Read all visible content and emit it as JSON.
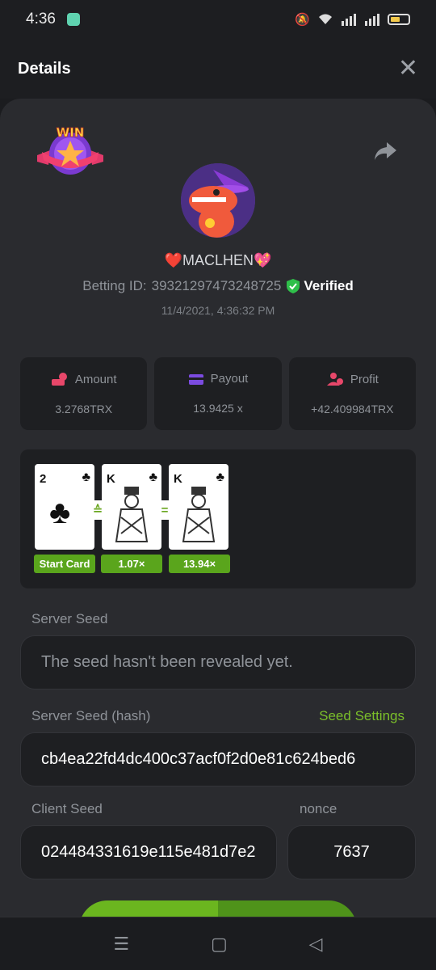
{
  "status": {
    "time": "4:36"
  },
  "header": {
    "title": "Details",
    "close_label": "✕"
  },
  "player": {
    "name": "MACLHEN",
    "betting_id_label": "Betting ID:",
    "betting_id": "39321297473248725",
    "verified_label": "Verified",
    "datetime": "11/4/2021, 4:36:32 PM"
  },
  "stats": [
    {
      "label": "Amount",
      "value": "3.2768TRX",
      "icon": "money-bag-icon",
      "color": "#e8476a"
    },
    {
      "label": "Payout",
      "value": "13.9425 x",
      "icon": "wallet-icon",
      "color": "#7b4be0"
    },
    {
      "label": "Profit",
      "value": "+42.409984TRX",
      "icon": "user-coin-icon",
      "color": "#e8476a"
    }
  ],
  "cards": [
    {
      "rank": "2",
      "suit": "♣",
      "multiplier": "Start Card"
    },
    {
      "rank": "K",
      "suit": "♣",
      "multiplier": "1.07×"
    },
    {
      "rank": "K",
      "suit": "♣",
      "multiplier": "13.94×"
    }
  ],
  "operators": [
    "≙",
    "="
  ],
  "seeds": {
    "server_seed_label": "Server Seed",
    "server_seed_value": "The seed hasn't been revealed yet.",
    "server_hash_label": "Server Seed (hash)",
    "seed_settings_label": "Seed Settings",
    "server_hash_value": "cb4ea22fd4dc400c37acf0f2d0e81c624bed6",
    "client_seed_label": "Client Seed",
    "client_seed_value": "024484331619e115e481d7e2",
    "nonce_label": "nonce",
    "nonce_value": "7637"
  },
  "colors": {
    "accent_green": "#6bb61f",
    "link_green": "#7bbf2a",
    "verified_green": "#2fbf4a"
  }
}
